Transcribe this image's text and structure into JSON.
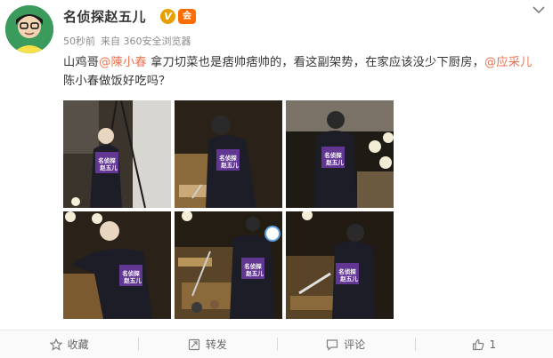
{
  "post": {
    "username": "名侦探赵五儿",
    "verified_badge": "V",
    "member_badge": "会",
    "time": "50秒前",
    "source": "来自 360安全浏览器",
    "text": {
      "p1": "山鸡哥",
      "m1": "@陳小春",
      "p2": " 拿刀切菜也是痞帅痞帅的，看这副架势，在家应该没少下厨房，",
      "m2": "@应采儿",
      "p3": " 陈小春做饭好吃吗？"
    },
    "watermark": [
      "名侦探",
      "赵五儿"
    ],
    "photos": [
      {
        "scene": "kitchen-tripod"
      },
      {
        "scene": "cutting-board"
      },
      {
        "scene": "dark-kitchen"
      },
      {
        "scene": "leaning-counter"
      },
      {
        "scene": "food-counter"
      },
      {
        "scene": "knife-board"
      }
    ]
  },
  "actions": [
    {
      "label": "收藏",
      "icon": "star-icon"
    },
    {
      "label": "转发",
      "icon": "repost-icon"
    },
    {
      "label": "评论",
      "icon": "comment-icon"
    },
    {
      "label": "1",
      "icon": "thumbs-up-icon"
    }
  ],
  "colors": {
    "mention": "#eb7350",
    "meta": "#8b8b8b",
    "accent": "#ff8200"
  }
}
